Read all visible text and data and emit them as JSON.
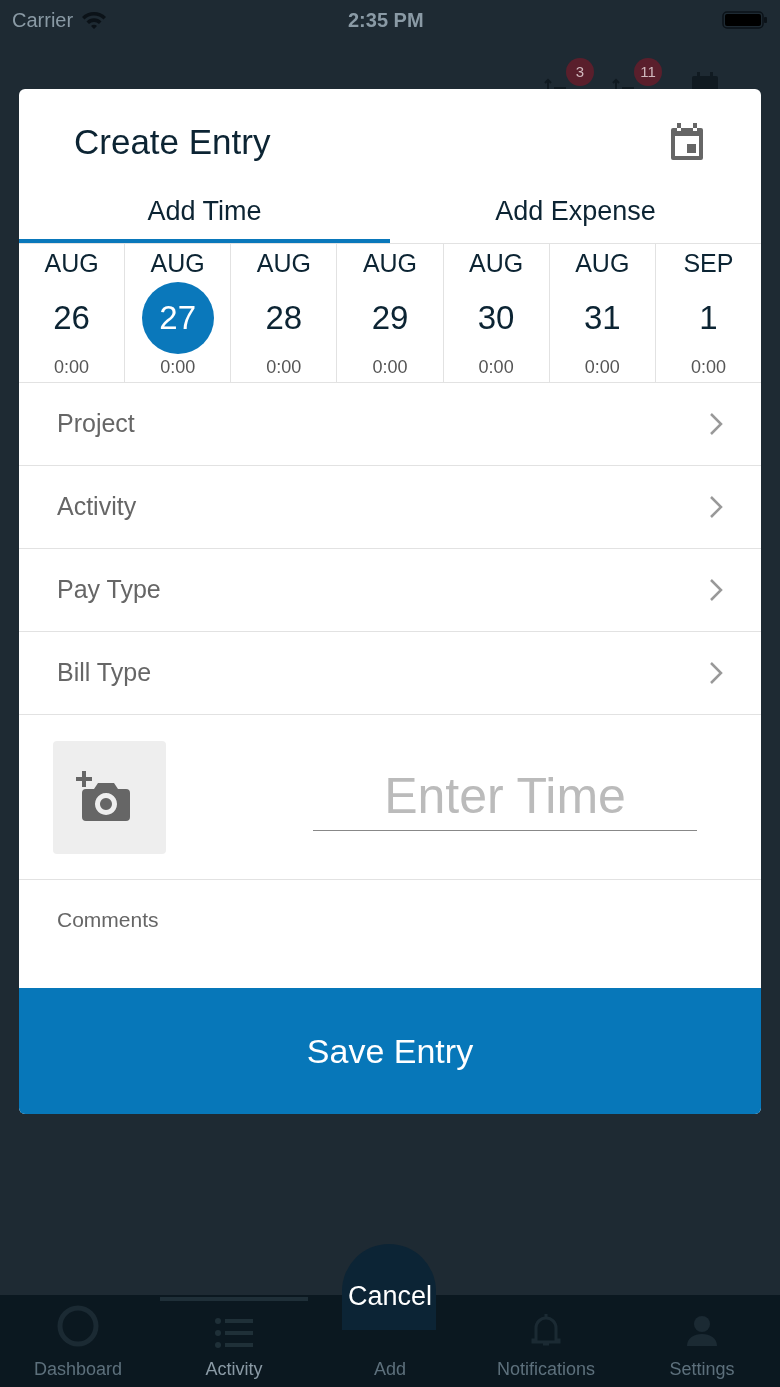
{
  "status_bar": {
    "carrier": "Carrier",
    "time": "2:35 PM"
  },
  "background": {
    "badges": [
      "3",
      "11"
    ],
    "tab_bar": [
      {
        "label": "Dashboard",
        "selected": false
      },
      {
        "label": "Activity",
        "selected": true
      },
      {
        "label": "Add",
        "selected": false
      },
      {
        "label": "Notifications",
        "selected": false
      },
      {
        "label": "Settings",
        "selected": false
      }
    ]
  },
  "dialog": {
    "title": "Create Entry",
    "tabs": [
      {
        "label": "Add Time",
        "selected": true
      },
      {
        "label": "Add Expense",
        "selected": false
      }
    ],
    "days": [
      {
        "month": "AUG",
        "day": "26",
        "hours": "0:00",
        "selected": false
      },
      {
        "month": "AUG",
        "day": "27",
        "hours": "0:00",
        "selected": true
      },
      {
        "month": "AUG",
        "day": "28",
        "hours": "0:00",
        "selected": false
      },
      {
        "month": "AUG",
        "day": "29",
        "hours": "0:00",
        "selected": false
      },
      {
        "month": "AUG",
        "day": "30",
        "hours": "0:00",
        "selected": false
      },
      {
        "month": "AUG",
        "day": "31",
        "hours": "0:00",
        "selected": false
      },
      {
        "month": "SEP",
        "day": "1",
        "hours": "0:00",
        "selected": false
      }
    ],
    "fields": [
      "Project",
      "Activity",
      "Pay Type",
      "Bill Type"
    ],
    "time_input": {
      "placeholder": "Enter Time"
    },
    "comments": {
      "placeholder": "Comments"
    },
    "save_button": "Save Entry"
  },
  "cancel_button": "Cancel"
}
